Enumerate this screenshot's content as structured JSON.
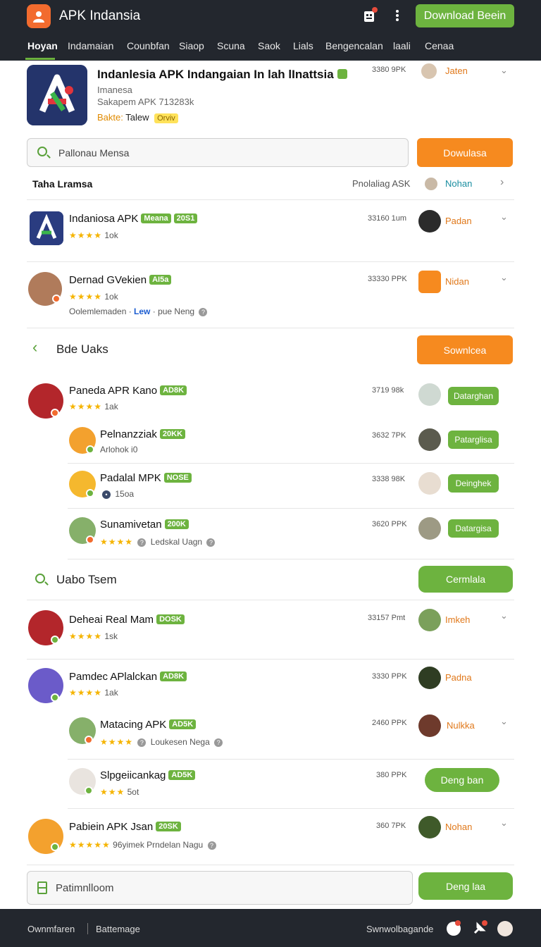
{
  "app": {
    "title": "APK Indansia",
    "download_button": "Download Beein"
  },
  "nav": [
    "Hoyan",
    "Indamaian",
    "Counbfan",
    "Siaop",
    "Scuna",
    "Saok",
    "Lials",
    "Bengencalan",
    "laali",
    "Cenaa"
  ],
  "hero": {
    "title": "Indanlesia APK Indangaian In lah lInattsia",
    "subtitle": "Imanesa",
    "size": "Sakapem APK 713283k",
    "meta_label": "Bakte:",
    "meta_value": "Talew",
    "badge": "Orviv",
    "price": "3380 9PK",
    "user": "Jaten"
  },
  "search": {
    "placeholder": "Pallonau Mensa",
    "button": "Dowulasa"
  },
  "tabrow": {
    "left": "Taha Lramsa",
    "right": "Pnolaliag ASK",
    "user": "Nohan"
  },
  "rows_top": [
    {
      "name": "Indaniosa APK",
      "tags": [
        "Meana",
        "20S1"
      ],
      "stars": "★★★★",
      "count": "1ok",
      "size": "33160 1um",
      "user": "Padan"
    },
    {
      "name": "Dernad GVekien",
      "tags": [
        "AI5a"
      ],
      "stars": "★★★★",
      "count": "1ok",
      "size": "33330 PPK",
      "user": "Nidan",
      "extra_a": "Oolemlemaden",
      "extra_b": "Lew",
      "extra_c": "pue Neng"
    }
  ],
  "section1": {
    "title": "Bde Uaks",
    "button": "Sownlcea"
  },
  "rows_mid": [
    {
      "name": "Paneda APR Kano",
      "tags": [
        "AD8K"
      ],
      "stars": "★★★★",
      "count": "1ak",
      "size": "3719 98k",
      "action": "Datarghan"
    },
    {
      "name": "Pelnanzziak",
      "tags": [
        "20KK"
      ],
      "sub": "Arlohok",
      "count": "i0",
      "size": "3632 7PK",
      "action": "Patarglisa"
    },
    {
      "name": "Padalal MPK",
      "tags": [
        "NOSE"
      ],
      "sub": "15oa",
      "size": "3338 98K",
      "action": "Deinghek"
    },
    {
      "name": "Sunamivetan",
      "tags": [
        "200K"
      ],
      "stars": "★★★★",
      "sub": "Ledskal Uagn",
      "size": "3620 PPK",
      "action": "Datargisa"
    }
  ],
  "section2": {
    "title": "Uabo Tsem",
    "button": "Cermlala"
  },
  "rows_bottom": [
    {
      "name": "Deheai Real Mam",
      "tags": [
        "DOSK"
      ],
      "stars": "★★★★",
      "count": "1sk",
      "size": "33157 Pmt",
      "user": "Imkeh"
    },
    {
      "name": "Pamdec APlalckan",
      "tags": [
        "AD8K"
      ],
      "stars": "★★★★",
      "count": "1ak",
      "size": "3330 PPK",
      "user": "Padna"
    },
    {
      "name": "Matacing APK",
      "tags": [
        "AD5K"
      ],
      "stars": "★★★★",
      "sub": "Loukesen Nega",
      "size": "2460 PPK",
      "user": "Nulkka"
    },
    {
      "name": "Slpgeiicankag",
      "tags": [
        "AD5K"
      ],
      "stars": "★★★",
      "count": "5ot",
      "size": "380 PPK",
      "action": "Deng ban"
    },
    {
      "name": "Pabiein APK Jsan",
      "tags": [
        "20SK"
      ],
      "stars": "★★★★★",
      "sub": "96yimek Prndelan Nagu",
      "size": "360 7PK",
      "user": "Nohan"
    }
  ],
  "bottom_bar": {
    "placeholder": "Patimnlloom",
    "button": "Deng laa"
  },
  "footer": {
    "left": "Ownmfaren",
    "mid": "Battemage",
    "right": "Swnwolbagande"
  },
  "colors": {
    "green": "#6db33f",
    "orange": "#f68a1f",
    "dark": "#23272e"
  }
}
